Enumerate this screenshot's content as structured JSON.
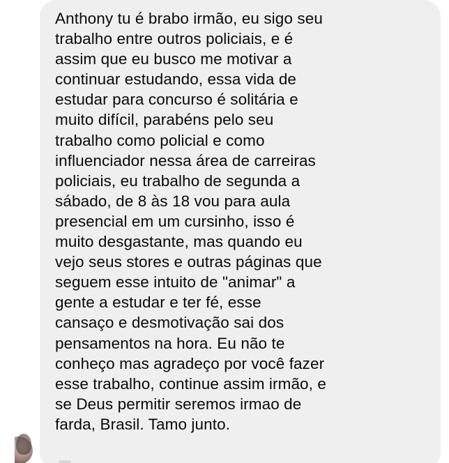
{
  "conversation": {
    "message": {
      "text": "Anthony tu é brabo irmão, eu sigo seu\ntrabalho entre outros policiais, e é\nassim que eu busco me motivar a\ncontinuar estudando, essa vida de\nestudar para concurso é solitária e\nmuito difícil, parabéns pelo seu\ntrabalho como policial e como\ninfluenciador nessa área de carreiras\npoliciais, eu trabalho de segunda a\nsábado, de 8 às 18 vou para aula\npresencial em um cursinho, isso é\nmuito desgastante, mas quando eu\nvejo seus stores e outras páginas que\nseguem esse intuito de \"animar\" a\ngente a estudar e ter fé,  esse\ncansaço e desmotivação sai dos\npensamentos na hora. Eu não te\nconheço mas agradeço por você fazer\nesse trabalho, continue assim irmão, e\nse Deus permitir seremos irmao de\nfarda, Brasil. Tamo junto."
    },
    "colors": {
      "bubble_background": "#efefef",
      "text": "#0a0a0a",
      "page_background": "#ffffff"
    }
  }
}
